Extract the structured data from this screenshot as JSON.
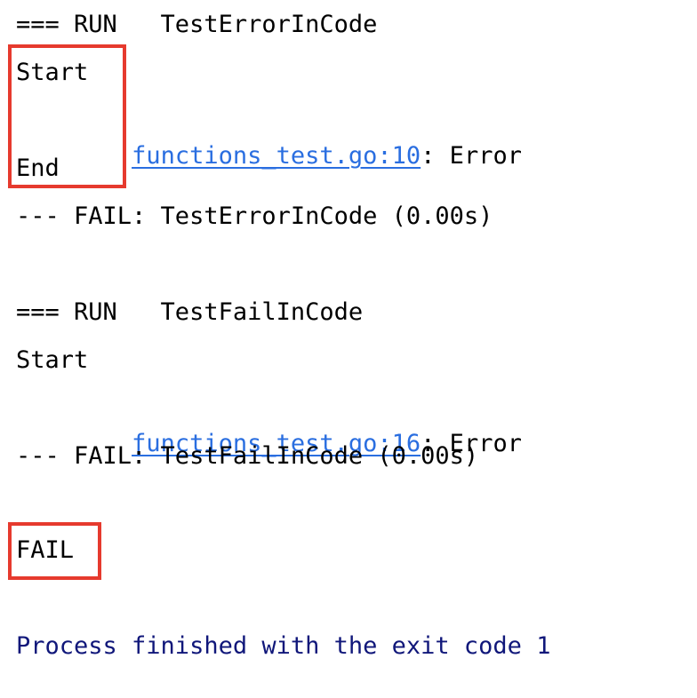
{
  "console": {
    "background_color": "#ffffff",
    "text_color": "#000000",
    "link_color": "#2a6ee0",
    "exit_text_color": "#10177a",
    "highlight_color": "#e63a2e",
    "lines": [
      {
        "id": "run-error-test",
        "text": "=== RUN   TestErrorInCode"
      },
      {
        "id": "start-1",
        "text": "Start"
      },
      {
        "id": "trace-1-link",
        "text": "    functions_test.go:10"
      },
      {
        "id": "trace-1-msg",
        "text": ": Error"
      },
      {
        "id": "end-1",
        "text": "End"
      },
      {
        "id": "fail-error-test",
        "text": "--- FAIL: TestErrorInCode (0.00s)"
      },
      {
        "id": "run-fail-test",
        "text": "=== RUN   TestFailInCode"
      },
      {
        "id": "start-2",
        "text": "Start"
      },
      {
        "id": "trace-2-link",
        "text": "    functions_test.go:16"
      },
      {
        "id": "trace-2-msg",
        "text": ": Error"
      },
      {
        "id": "fail-fail-test",
        "text": "--- FAIL: TestFailInCode (0.00s)"
      },
      {
        "id": "overall-result",
        "text": "FAIL"
      },
      {
        "id": "process-exit",
        "text": "Process finished with the exit code 1"
      }
    ],
    "line_1": "=== RUN   TestErrorInCode",
    "line_2": "Start",
    "line_3_indent": "    ",
    "line_3_link": "functions_test.go:10",
    "line_3_rest": ": Error",
    "line_4": "End",
    "line_5": "--- FAIL: TestErrorInCode (0.00s)",
    "line_6": "=== RUN   TestFailInCode",
    "line_7": "Start",
    "line_8_indent": "    ",
    "line_8_link": "functions_test.go:16",
    "line_8_rest": ": Error",
    "line_9": "--- FAIL: TestFailInCode (0.00s)",
    "line_10": "FAIL",
    "line_11": "Process finished with the exit code 1"
  },
  "annotations": {
    "box_1_label": "start-end-block-highlight",
    "box_2_label": "fail-result-highlight"
  }
}
